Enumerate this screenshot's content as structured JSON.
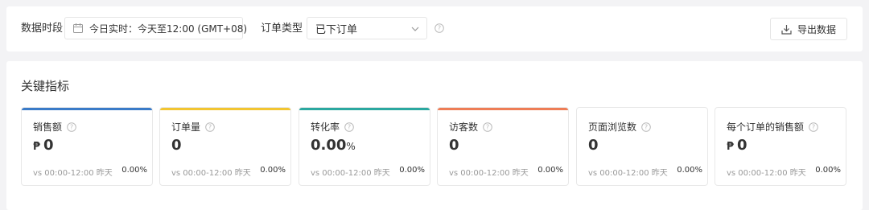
{
  "filters": {
    "period_label": "数据时段",
    "period_value": "今日实时：今天至12:00 (GMT+08)",
    "order_type_label": "订单类型",
    "order_type_value": "已下订单",
    "export_label": "导出数据"
  },
  "panel": {
    "title": "关键指标"
  },
  "metrics": [
    {
      "label": "销售额",
      "currency": "₱",
      "value": "0",
      "unit": "",
      "compare": "vs 00:00-12:00 昨天",
      "change": "0.00%",
      "color": "#3a7bc8"
    },
    {
      "label": "订单量",
      "currency": "",
      "value": "0",
      "unit": "",
      "compare": "vs 00:00-12:00 昨天",
      "change": "0.00%",
      "color": "#f2c531"
    },
    {
      "label": "转化率",
      "currency": "",
      "value": "0.00",
      "unit": "%",
      "compare": "vs 00:00-12:00 昨天",
      "change": "0.00%",
      "color": "#2ba8a0"
    },
    {
      "label": "访客数",
      "currency": "",
      "value": "0",
      "unit": "",
      "compare": "vs 00:00-12:00 昨天",
      "change": "0.00%",
      "color": "#ee7d56"
    },
    {
      "label": "页面浏览数",
      "currency": "",
      "value": "0",
      "unit": "",
      "compare": "vs 00:00-12:00 昨天",
      "change": "0.00%",
      "color": ""
    },
    {
      "label": "每个订单的销售额",
      "currency": "₱",
      "value": "0",
      "unit": "",
      "compare": "vs 00:00-12:00 昨天",
      "change": "0.00%",
      "color": ""
    }
  ]
}
